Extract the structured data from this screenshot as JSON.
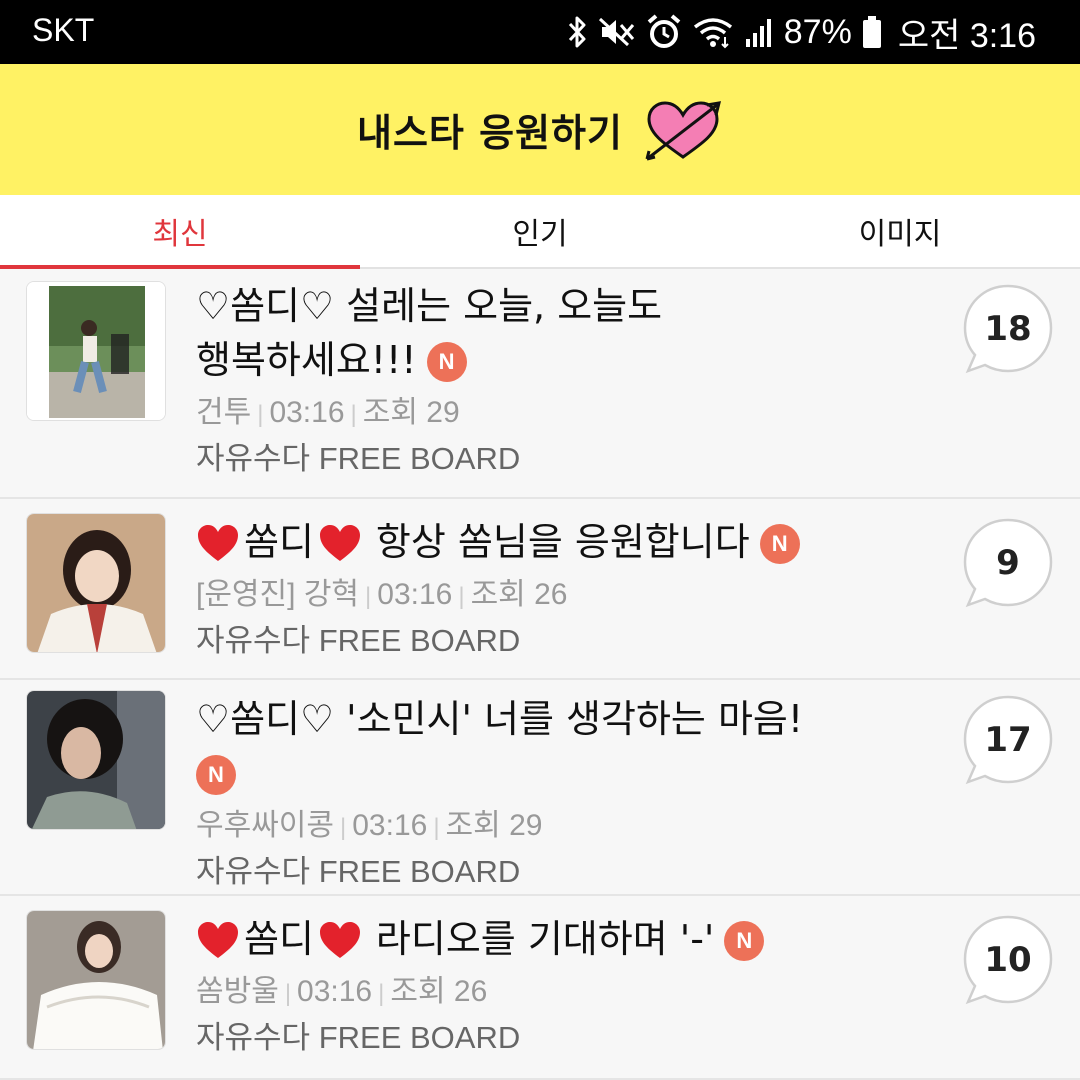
{
  "status_bar": {
    "carrier": "SKT",
    "battery": "87%",
    "time": "오전 3:16",
    "icons": [
      "bluetooth-icon",
      "mute-vibrate-icon",
      "alarm-icon",
      "wifi-icon",
      "signal-icon",
      "battery-icon"
    ]
  },
  "header": {
    "title": "내스타 응원하기",
    "logo_icon": "heart-arrow-icon",
    "logo_color": "#f47eb4"
  },
  "tabs": [
    {
      "label": "최신",
      "active": true
    },
    {
      "label": "인기",
      "active": false
    },
    {
      "label": "이미지",
      "active": false
    }
  ],
  "colors": {
    "accent": "#e0363c",
    "header_bg": "#fff264",
    "new_badge": "#ed7158"
  },
  "posts": [
    {
      "heart_style": "outline",
      "heart_left": "♡",
      "name": "쏨디",
      "heart_right": "♡",
      "title_line1": "설레는 오늘, 오늘도",
      "title_line2": "행복하세요!!!",
      "badge": "N",
      "prefix": "",
      "author": "건투",
      "time": "03:16",
      "views": "조회 29",
      "board": "자유수다 FREE BOARD",
      "comments": "18"
    },
    {
      "heart_style": "red",
      "name": "쏨디",
      "title_line1": "항상 쏨님을 응원합니다",
      "title_line2": "",
      "badge": "N",
      "prefix": "[운영진]",
      "author": "강혁",
      "time": "03:16",
      "views": "조회 26",
      "board": "자유수다 FREE BOARD",
      "comments": "9"
    },
    {
      "heart_style": "outline",
      "heart_left": "♡",
      "name": "쏨디",
      "heart_right": "♡",
      "title_line1": "'소민시' 너를 생각하는 마음!",
      "title_line2": "",
      "badge": "N",
      "prefix": "",
      "author": "우후싸이콩",
      "time": "03:16",
      "views": "조회 29",
      "board": "자유수다 FREE BOARD",
      "comments": "17"
    },
    {
      "heart_style": "red",
      "name": "쏨디",
      "title_line1": "라디오를 기대하며 '-'",
      "title_line2": "",
      "badge": "N",
      "prefix": "",
      "author": "쏨방울",
      "time": "03:16",
      "views": "조회 26",
      "board": "자유수다 FREE BOARD",
      "comments": "10"
    }
  ]
}
